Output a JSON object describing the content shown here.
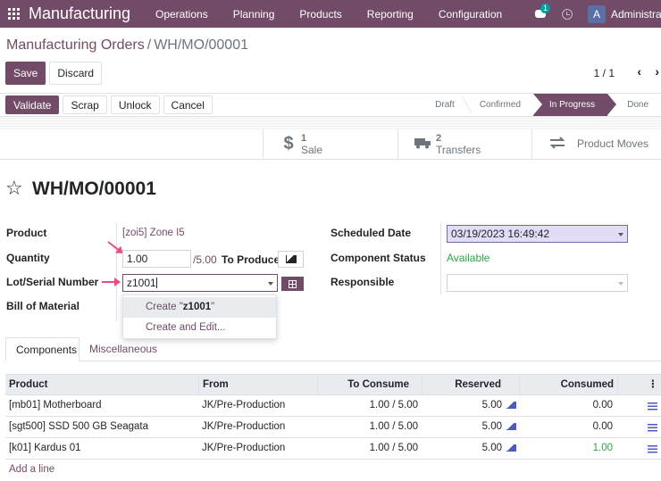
{
  "navbar": {
    "brand": "Manufacturing",
    "menu": [
      "Operations",
      "Planning",
      "Products",
      "Reporting",
      "Configuration"
    ],
    "chat_badge": "1",
    "avatar_letter": "A",
    "user_name": "Administrat"
  },
  "breadcrumb": {
    "parent": "Manufacturing Orders",
    "separator": "/",
    "current": "WH/MO/00001"
  },
  "control": {
    "save_label": "Save",
    "discard_label": "Discard",
    "pager": "1 / 1",
    "prev_icon": "‹",
    "next_icon": "›"
  },
  "actions": {
    "validate": "Validate",
    "scrap": "Scrap",
    "unlock": "Unlock",
    "cancel": "Cancel"
  },
  "stages": [
    {
      "label": "Draft",
      "active": false
    },
    {
      "label": "Confirmed",
      "active": false
    },
    {
      "label": "In Progress",
      "active": true
    },
    {
      "label": "Done",
      "active": false
    }
  ],
  "smart_buttons": {
    "sale": {
      "icon": "dollar-icon",
      "count": "1",
      "label": "Sale"
    },
    "transfers": {
      "icon": "truck-icon",
      "count": "2",
      "label": "Transfers"
    },
    "moves": {
      "icon": "exchange-icon",
      "label": "Product Moves"
    }
  },
  "record": {
    "title": "WH/MO/00001"
  },
  "form": {
    "product_label": "Product",
    "product_value": "[zoi5] Zone I5",
    "quantity_label": "Quantity",
    "quantity_value": "1.00",
    "quantity_total": "/5.00",
    "to_produce": "To Produce",
    "lot_label": "Lot/Serial Number",
    "lot_value": "z1001",
    "bom_label": "Bill of Material",
    "scheduled_label": "Scheduled Date",
    "scheduled_value": "03/19/2023 16:49:42",
    "component_status_label": "Component Status",
    "component_status_value": "Available",
    "responsible_label": "Responsible",
    "responsible_value": ""
  },
  "dropdown": {
    "create_prefix": "Create \"",
    "create_term": "z1001",
    "create_suffix": "\"",
    "create_edit": "Create and Edit..."
  },
  "tabs": [
    "Components",
    "Miscellaneous"
  ],
  "table": {
    "headers": [
      "Product",
      "From",
      "To Consume",
      "Reserved",
      "Consumed"
    ],
    "rows": [
      {
        "product": "[mb01] Motherboard",
        "from": "JK/Pre-Production",
        "to_consume": "1.00 / 5.00",
        "reserved": "5.00",
        "consumed": "0.00"
      },
      {
        "product": "[sgt500] SSD 500 GB Seagata",
        "from": "JK/Pre-Production",
        "to_consume": "1.00 / 5.00",
        "reserved": "5.00",
        "consumed": "0.00"
      },
      {
        "product": "[k01] Kardus 01",
        "from": "JK/Pre-Production",
        "to_consume": "1.00 / 5.00",
        "reserved": "5.00",
        "consumed": "1.00"
      }
    ],
    "add_line": "Add a line"
  },
  "colors": {
    "brand": "#714b67",
    "available": "#28a745",
    "annotation_arrow": "#e84a8a"
  }
}
